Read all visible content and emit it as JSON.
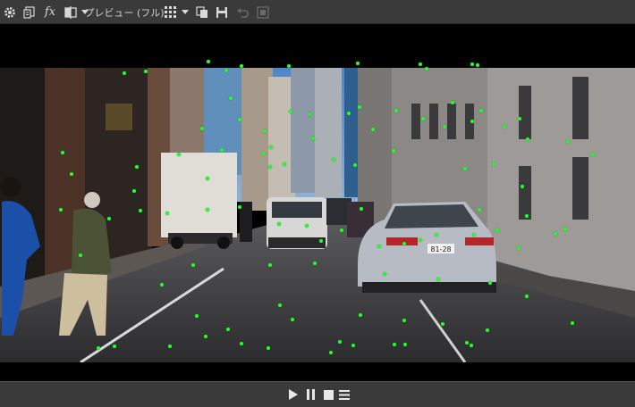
{
  "toolbar": {
    "preview_label": "プレビュー (フル)",
    "icons": [
      "gear-icon",
      "export-icon",
      "fx-icon",
      "compare-icon",
      "chevron-down-icon",
      "preview-quality-dropdown",
      "grid-icon",
      "chevron-down-icon",
      "copy-frame-icon",
      "save-frame-icon",
      "undo-icon",
      "disabled-icon"
    ],
    "fx_label": "fx"
  },
  "viewer": {
    "tracking_color": "#22ff2a",
    "license_plate": "81-28"
  },
  "transport": {
    "icons": [
      "play-icon",
      "pause-icon",
      "stop-icon",
      "menu-icon"
    ]
  }
}
